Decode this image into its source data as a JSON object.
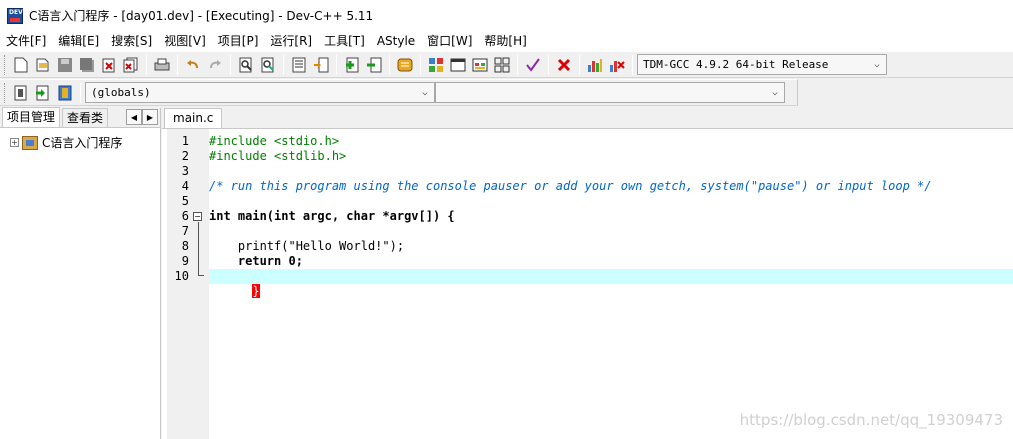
{
  "window": {
    "title": "C语言入门程序 - [day01.dev] - [Executing] - Dev-C++ 5.11",
    "icon_text": "DEV"
  },
  "menu": [
    "文件[F]",
    "编辑[E]",
    "搜索[S]",
    "视图[V]",
    "项目[P]",
    "运行[R]",
    "工具[T]",
    "AStyle",
    "窗口[W]",
    "帮助[H]"
  ],
  "toolbar": {
    "compiler": "TDM-GCC 4.9.2 64-bit Release",
    "scope": "(globals)",
    "member": ""
  },
  "left_panel": {
    "tabs": [
      "项目管理",
      "查看类"
    ],
    "tree_expander": "+",
    "project": "C语言入门程序"
  },
  "editor": {
    "tab": "main.c",
    "line_numbers": [
      "1",
      "2",
      "3",
      "4",
      "5",
      "6",
      "7",
      "8",
      "9",
      "10"
    ],
    "lines": [
      "#include <stdio.h>",
      "#include <stdlib.h>",
      "",
      "/* run this program using the console pauser or add your own getch, system(\"pause\") or input loop */",
      "",
      "int main(int argc, char *argv[]) {",
      "",
      "    printf(\"Hello World!\");",
      "    return 0;",
      "}"
    ],
    "current_line": 10
  },
  "watermark": "https://blog.csdn.net/qq_19309473",
  "colors": {
    "preprocessor": "#008000",
    "comment": "#0066cc",
    "string": "#0000ff",
    "number": "#ff0000",
    "highlight": "#ccffff"
  }
}
